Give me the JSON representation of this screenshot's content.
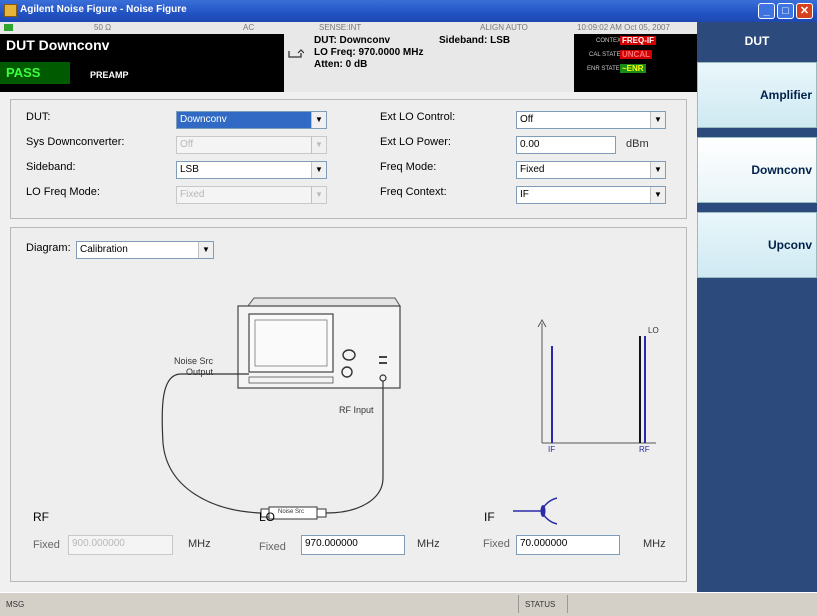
{
  "window": {
    "title": "Agilent Noise Figure - Noise Figure"
  },
  "status_top": {
    "impedance": "50 Ω",
    "coupling": "AC",
    "sense": "SENSE:INT",
    "align": "ALIGN AUTO",
    "datetime": "10:09:02 AM Oct 05, 2007"
  },
  "header": {
    "dut_name": "DUT Downconv",
    "pass_label": "PASS",
    "preamp_label": "PREAMP",
    "dut_line": "DUT: Downconv",
    "sideband_line": "Sideband: LSB",
    "lo_freq_line": "LO Freq: 970.0000 MHz",
    "atten_line": "Atten: 0 dB",
    "context_label": "CONTEXT",
    "context_value": "FREQ-IF",
    "cal_state_label": "CAL STATE",
    "cal_state_value": "UNCAL",
    "enr_state_label": "ENR STATE",
    "enr_state_value": "~ENR"
  },
  "panel": {
    "title": "DUT",
    "softkeys": [
      "Amplifier",
      "Downconv",
      "Upconv"
    ]
  },
  "settings": {
    "dut": {
      "label": "DUT:",
      "value": "Downconv"
    },
    "sys_downconverter": {
      "label": "Sys Downconverter:",
      "value": "Off"
    },
    "sideband": {
      "label": "Sideband:",
      "value": "LSB"
    },
    "lo_freq_mode": {
      "label": "LO Freq Mode:",
      "value": "Fixed"
    },
    "ext_lo_control": {
      "label": "Ext LO Control:",
      "value": "Off"
    },
    "ext_lo_power": {
      "label": "Ext LO Power:",
      "value": "0.00",
      "unit": "dBm"
    },
    "freq_mode": {
      "label": "Freq Mode:",
      "value": "Fixed"
    },
    "freq_context": {
      "label": "Freq Context:",
      "value": "IF"
    }
  },
  "diagram": {
    "label": "Diagram:",
    "value": "Calibration",
    "noise_src_output": [
      "Noise Src",
      "Output"
    ],
    "rf_input": "RF Input",
    "noise_src_box": "Noise Src",
    "spectrum": {
      "lo": "LO",
      "if": "IF",
      "rf": "RF"
    }
  },
  "freqs": {
    "rf": {
      "title": "RF",
      "mode": "Fixed",
      "value": "900.000000",
      "unit": "MHz"
    },
    "lo": {
      "title": "LO",
      "mode": "Fixed",
      "value": "970.000000",
      "unit": "MHz"
    },
    "if": {
      "title": "IF",
      "mode": "Fixed",
      "value": "70.000000",
      "unit": "MHz"
    }
  },
  "statusbar": {
    "msg": "MSG",
    "status": "STATUS"
  },
  "colors": {
    "pass_bg": "#005a00",
    "pass_text": "#3cff3c",
    "context": "#ff1010",
    "enr": "#ffff00",
    "panel": "#2c4a7c"
  }
}
